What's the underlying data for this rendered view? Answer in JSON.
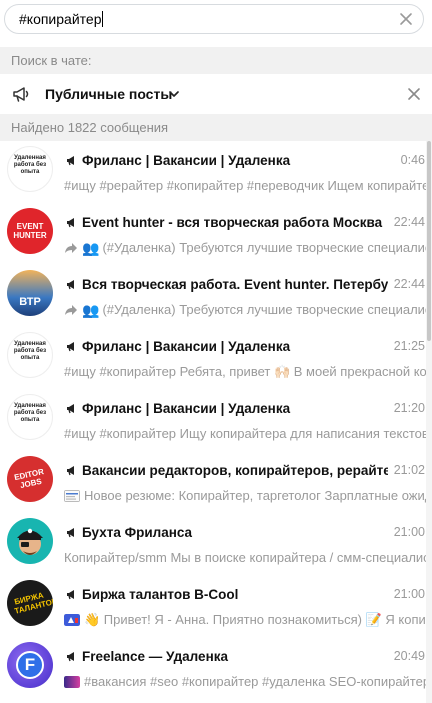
{
  "search": {
    "query": "#копирайтер"
  },
  "labels": {
    "search_in_chats": "Поиск в чате:",
    "found": "Найдено 1822 сообщения"
  },
  "filter": {
    "label": "Публичные посты"
  },
  "results": [
    {
      "title": "Фриланс | Вакансии | Удаленка",
      "time": "0:46",
      "snippet": "#ищу #рерайтер #копирайтер #переводчик Ищем копирайтера",
      "avatar_text": "Удаленная работа без опыта",
      "avatar_color": "#ffffff"
    },
    {
      "title": "Event hunter - вся творческая работа Москва",
      "time": "22:44",
      "snippet": "(#Удаленка) Требуются лучшие творческие специалисты",
      "avatar_text": "EVENT HUNTER",
      "avatar_color": "#e0252b"
    },
    {
      "title": "Вся творческая работа. Event hunter. Петербург",
      "time": "22:44",
      "snippet": "(#Удаленка) Требуются лучшие творческие специалисты",
      "avatar_text": "ВТР",
      "avatar_color": "#3a78c2"
    },
    {
      "title": "Фриланс | Вакансии | Удаленка",
      "time": "21:25",
      "snippet": "#ищу #копирайтер  Ребята, привет 🙌🏻  В моей прекрасной команде",
      "avatar_text": "Удаленная работа без опыта",
      "avatar_color": "#ffffff"
    },
    {
      "title": "Фриланс | Вакансии | Удаленка",
      "time": "21:20",
      "snippet": "#ищу #копирайтер Ищу копирайтера для написания текстов",
      "avatar_text": "Удаленная работа без опыта",
      "avatar_color": "#ffffff"
    },
    {
      "title": "Вакансии редакторов, копирайтеров, рерайтеров",
      "time": "21:02",
      "snippet": "Новое резюме: Копирайтер, таргетолог  Зарплатные ожидания",
      "avatar_text": "EDITOR JOBS",
      "avatar_color": "#d62f2f"
    },
    {
      "title": "Бухта Фриланса",
      "time": "21:00",
      "snippet": "Копирайтер/smm  Мы в поиске копирайтера / смм-специалиста",
      "avatar_text": "",
      "avatar_color": "#18b5b0"
    },
    {
      "title": "Биржа талантов B-Cool",
      "time": "21:00",
      "snippet": "👋 Привет! Я - Анна. Приятно познакомиться) 📝 Я копирайтер",
      "avatar_text": "БИРЖА ТАЛАНТОВ",
      "avatar_color": "#1a1a1a"
    },
    {
      "title": "Freelance — Удаленка",
      "time": "20:49",
      "snippet": "#вакансия #seo #копирайтер #удаленка  SEO-копирайтер",
      "avatar_text": "F",
      "avatar_color": "#5b3fd6"
    }
  ],
  "colors": {
    "accent": "#e0252b",
    "muted_text": "#9a9a9a",
    "section_bg": "#f1f1f1"
  }
}
